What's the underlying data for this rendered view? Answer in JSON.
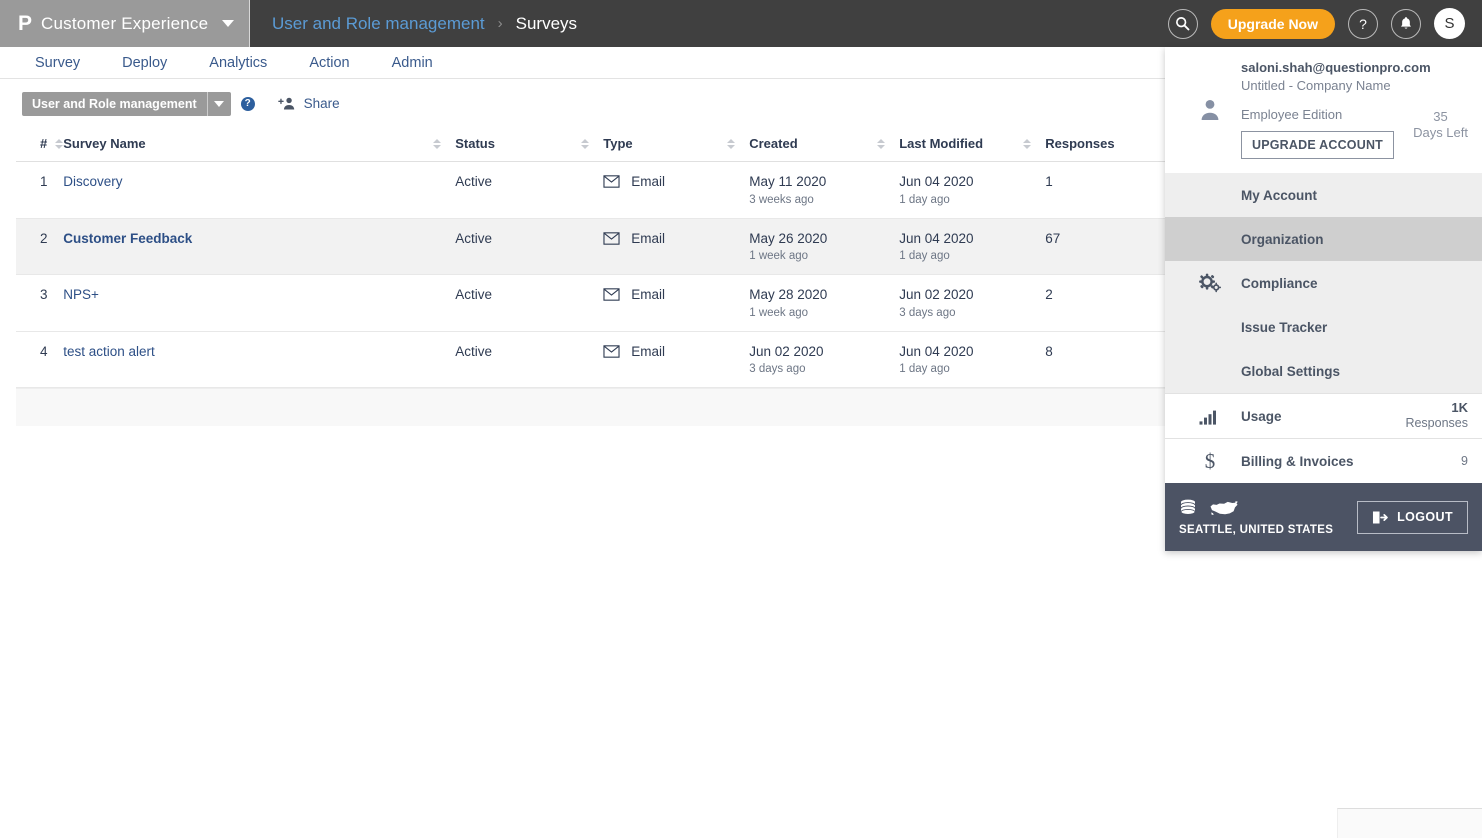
{
  "topbar": {
    "logo_glyph": "P",
    "brand_name": "Customer Experience",
    "breadcrumb": {
      "parent": "User and Role management",
      "separator": "›",
      "current": "Surveys"
    },
    "search_icon": "search-icon",
    "upgrade_label": "Upgrade Now",
    "help_glyph": "?",
    "notification_icon": "bell-icon",
    "avatar_initial": "S",
    "accent_orange": "#f5a11b",
    "brand_bg": "#9a9a9a",
    "bar_bg": "#404040",
    "link_blue": "#5b9bd5"
  },
  "nav": {
    "items": [
      {
        "label": "Survey"
      },
      {
        "label": "Deploy"
      },
      {
        "label": "Analytics"
      },
      {
        "label": "Action"
      },
      {
        "label": "Admin"
      }
    ]
  },
  "toolbar": {
    "select_value": "User and Role management",
    "help_label": "?",
    "share_label": "Share",
    "share_icon": "add-person-icon"
  },
  "table": {
    "columns": [
      {
        "key": "num",
        "label": "#",
        "sortable": true
      },
      {
        "key": "name",
        "label": "Survey Name",
        "sortable": true
      },
      {
        "key": "status",
        "label": "Status",
        "sortable": true
      },
      {
        "key": "type",
        "label": "Type",
        "sortable": true
      },
      {
        "key": "created",
        "label": "Created",
        "sortable": true
      },
      {
        "key": "modified",
        "label": "Last Modified",
        "sortable": true
      },
      {
        "key": "responses",
        "label": "Responses",
        "sortable": false
      }
    ],
    "rows": [
      {
        "num": "1",
        "name": "Discovery",
        "bold": false,
        "highlight": false,
        "status": "Active",
        "type": "Email",
        "created": "May 11 2020",
        "created_rel": "3 weeks ago",
        "modified": "Jun 04 2020",
        "modified_rel": "1 day ago",
        "responses": "1"
      },
      {
        "num": "2",
        "name": "Customer Feedback",
        "bold": true,
        "highlight": true,
        "status": "Active",
        "type": "Email",
        "created": "May 26 2020",
        "created_rel": "1 week ago",
        "modified": "Jun 04 2020",
        "modified_rel": "1 day ago",
        "responses": "67"
      },
      {
        "num": "3",
        "name": "NPS+",
        "bold": false,
        "highlight": false,
        "status": "Active",
        "type": "Email",
        "created": "May 28 2020",
        "created_rel": "1 week ago",
        "modified": "Jun 02 2020",
        "modified_rel": "3 days ago",
        "responses": "2"
      },
      {
        "num": "4",
        "name": "test action alert",
        "bold": false,
        "highlight": false,
        "status": "Active",
        "type": "Email",
        "created": "Jun 02 2020",
        "created_rel": "3 days ago",
        "modified": "Jun 04 2020",
        "modified_rel": "1 day ago",
        "responses": "8"
      }
    ]
  },
  "user_menu": {
    "email": "saloni.shah@questionpro.com",
    "company": "Untitled - Company Name",
    "edition": "Employee Edition",
    "upgrade_label": "UPGRADE ACCOUNT",
    "days_number": "35",
    "days_label": "Days Left",
    "avatar_icon": "user-avatar-icon",
    "group_icon": "gears-icon",
    "items": [
      {
        "label": "My Account",
        "active": false
      },
      {
        "label": "Organization",
        "active": true
      },
      {
        "label": "Compliance",
        "active": false
      },
      {
        "label": "Issue Tracker",
        "active": false
      },
      {
        "label": "Global Settings",
        "active": false
      }
    ],
    "usage": {
      "label": "Usage",
      "value": "1K",
      "sub": "Responses",
      "icon": "bar-chart-icon"
    },
    "billing": {
      "label": "Billing & Invoices",
      "value": "9",
      "icon": "dollar-icon"
    },
    "footer": {
      "location": "SEATTLE, UNITED STATES",
      "db_icon": "database-icon",
      "map_icon": "usa-map-icon",
      "logout_label": "LOGOUT",
      "logout_icon": "logout-icon",
      "bg": "#4c5364"
    }
  }
}
